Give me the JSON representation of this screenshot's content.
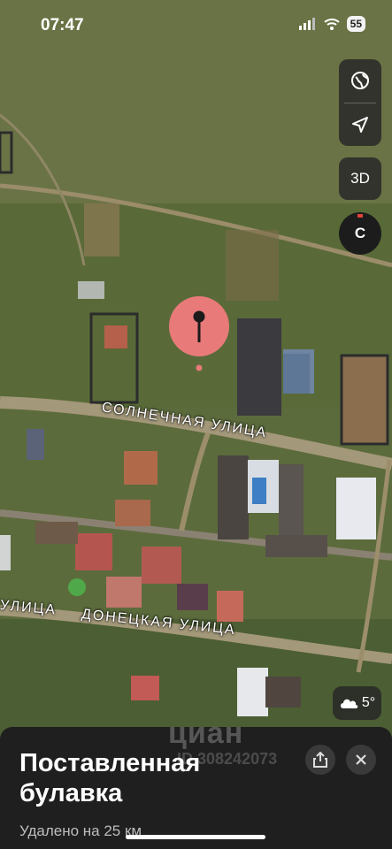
{
  "status_bar": {
    "time": "07:47",
    "battery": "55"
  },
  "map_controls": {
    "three_d_label": "3D",
    "compass_label": "C"
  },
  "streets": [
    {
      "name": "СОЛНЕЧНАЯ УЛИЦА"
    },
    {
      "name": "ДОНЕЦКАЯ УЛИЦА"
    },
    {
      "name": "УЛИЦА"
    }
  ],
  "weather": {
    "temperature": "5°",
    "icon": "cloud-icon"
  },
  "place_sheet": {
    "title": "Поставленная булавка",
    "distance": "Удалено на 25 км",
    "share_icon": "share-icon",
    "close_icon": "close-icon"
  },
  "watermark": {
    "brand": "циан",
    "id": "ID 308242073"
  },
  "pin": {
    "color": "#e87a7a"
  }
}
